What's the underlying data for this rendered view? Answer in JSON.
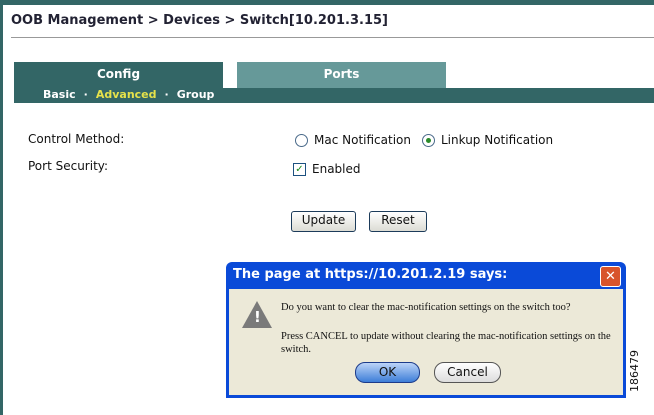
{
  "breadcrumb": "OOB Management > Devices > Switch[10.201.3.15]",
  "tabs": [
    {
      "label": "Config",
      "active": true
    },
    {
      "label": "Ports",
      "active": false
    }
  ],
  "subnav": {
    "items": [
      "Basic",
      "Advanced",
      "Group"
    ],
    "selected": "Advanced",
    "separator": "·"
  },
  "form": {
    "control_method_label": "Control Method:",
    "control_method_options": [
      "Mac Notification",
      "Linkup Notification"
    ],
    "control_method_selected": "Linkup Notification",
    "port_security_label": "Port Security:",
    "port_security_option": "Enabled",
    "port_security_checked": true,
    "update_label": "Update",
    "reset_label": "Reset"
  },
  "dialog": {
    "title": "The page at https://10.201.2.19 says:",
    "message1": "Do you want to clear the mac-notification settings on the switch too?",
    "message2": "Press CANCEL to update without clearing the mac-notification settings on the switch.",
    "ok_label": "OK",
    "cancel_label": "Cancel",
    "icon": "warning-icon"
  },
  "figure_number": "186479",
  "colors": {
    "brand": "#336666",
    "tab_inactive": "#669999",
    "selected_subnav": "#e6e24a"
  }
}
